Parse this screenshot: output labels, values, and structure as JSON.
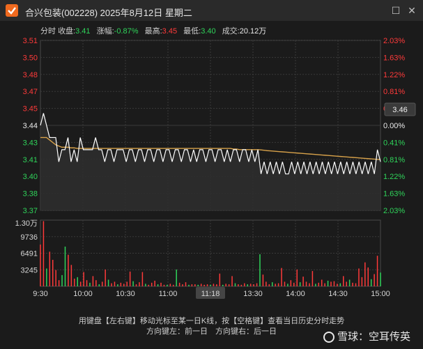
{
  "window": {
    "title": "合兴包装(002228) 2025年8月12日 星期二",
    "close_glyph": "✕",
    "maximize_glyph": "☐"
  },
  "info_bar": {
    "mode_label": "分时",
    "close_label": "收盘:",
    "close_value": "3.41",
    "change_label": "涨幅:",
    "change_value": "-0.87%",
    "high_label": "最高:",
    "high_value": "3.45",
    "low_label": "最低:",
    "low_value": "3.40",
    "volume_label": "成交:",
    "volume_value": "20.12万"
  },
  "current_price_tag": "3.46",
  "colors": {
    "up": "#ff3a3a",
    "down": "#2fd45a",
    "price_line": "#ffffff",
    "avg_line": "#d8a24a",
    "grid": "#3a3a3a",
    "background": "#1b1b1b"
  },
  "chart_data": {
    "type": "line",
    "price_axis": {
      "ticks": [
        "3.51",
        "3.50",
        "3.48",
        "3.47",
        "3.45",
        "3.44",
        "3.43",
        "3.41",
        "3.40",
        "3.38",
        "3.37"
      ],
      "tick_colors": [
        "up",
        "up",
        "up",
        "up",
        "up",
        "white",
        "down",
        "down",
        "down",
        "down",
        "down"
      ],
      "ylim": [
        3.37,
        3.51
      ],
      "prev_close": 3.44
    },
    "pct_axis": {
      "ticks": [
        "2.03%",
        "1.63%",
        "1.22%",
        "0.81%",
        "0.41%",
        "0.00%",
        "0.41%",
        "0.81%",
        "1.22%",
        "1.63%",
        "2.03%"
      ],
      "tick_colors": [
        "up",
        "up",
        "up",
        "up",
        "up",
        "white",
        "down",
        "down",
        "down",
        "down",
        "down"
      ]
    },
    "time_axis": {
      "ticks": [
        "9:30",
        "10:00",
        "10:30",
        "11:00",
        "11:18",
        "13:30",
        "14:00",
        "14:30",
        "15:00"
      ],
      "highlight": "11:18"
    },
    "volume_axis": {
      "ticks": [
        "1.30万",
        "9736",
        "6491",
        "3245"
      ],
      "ylim": [
        0,
        13000
      ]
    },
    "price_series": [
      3.44,
      3.45,
      3.44,
      3.43,
      3.43,
      3.43,
      3.41,
      3.42,
      3.42,
      3.43,
      3.41,
      3.42,
      3.41,
      3.43,
      3.42,
      3.42,
      3.42,
      3.42,
      3.43,
      3.42,
      3.42,
      3.41,
      3.42,
      3.42,
      3.41,
      3.42,
      3.42,
      3.42,
      3.41,
      3.42,
      3.42,
      3.41,
      3.42,
      3.42,
      3.41,
      3.42,
      3.42,
      3.41,
      3.42,
      3.42,
      3.41,
      3.42,
      3.42,
      3.41,
      3.42,
      3.42,
      3.41,
      3.42,
      3.42,
      3.41,
      3.42,
      3.41,
      3.42,
      3.42,
      3.41,
      3.42,
      3.42,
      3.41,
      3.42,
      3.42,
      3.41,
      3.42,
      3.41,
      3.42,
      3.42,
      3.41,
      3.42,
      3.42,
      3.41,
      3.42,
      3.41,
      3.42,
      3.4,
      3.41,
      3.4,
      3.41,
      3.4,
      3.41,
      3.4,
      3.41,
      3.4,
      3.4,
      3.41,
      3.4,
      3.41,
      3.4,
      3.41,
      3.4,
      3.41,
      3.4,
      3.41,
      3.4,
      3.41,
      3.4,
      3.41,
      3.4,
      3.41,
      3.4,
      3.41,
      3.4,
      3.41,
      3.4,
      3.41,
      3.4,
      3.41,
      3.4,
      3.41,
      3.4,
      3.41,
      3.4,
      3.42,
      3.41
    ],
    "avg_series": [
      3.43,
      3.43,
      3.43,
      3.428,
      3.426,
      3.424,
      3.423,
      3.422,
      3.422,
      3.422,
      3.4215,
      3.4215,
      3.421,
      3.421,
      3.421,
      3.421,
      3.421,
      3.421,
      3.421,
      3.421,
      3.421,
      3.421,
      3.421,
      3.421,
      3.421,
      3.421,
      3.421,
      3.421,
      3.421,
      3.421,
      3.421,
      3.421,
      3.421,
      3.421,
      3.421,
      3.421,
      3.421,
      3.421,
      3.421,
      3.421,
      3.421,
      3.421,
      3.421,
      3.421,
      3.421,
      3.421,
      3.421,
      3.421,
      3.421,
      3.421,
      3.421,
      3.421,
      3.421,
      3.421,
      3.421,
      3.421,
      3.421,
      3.421,
      3.421,
      3.421,
      3.421,
      3.421,
      3.421,
      3.4205,
      3.4205,
      3.42,
      3.42,
      3.42,
      3.42,
      3.42,
      3.42,
      3.42,
      3.4198,
      3.4195,
      3.4192,
      3.419,
      3.4188,
      3.4186,
      3.4184,
      3.4182,
      3.418,
      3.4178,
      3.4176,
      3.4174,
      3.4172,
      3.417,
      3.4168,
      3.4166,
      3.4164,
      3.4162,
      3.416,
      3.4158,
      3.4156,
      3.4154,
      3.4152,
      3.415,
      3.4148,
      3.4146,
      3.4144,
      3.4142,
      3.414,
      3.4138,
      3.4136,
      3.4134,
      3.4132,
      3.413,
      3.4128,
      3.4126,
      3.4124,
      3.4122,
      3.412,
      3.412
    ],
    "volume_series": [
      {
        "v": 8200,
        "d": "up"
      },
      {
        "v": 12800,
        "d": "up"
      },
      {
        "v": 3500,
        "d": "down"
      },
      {
        "v": 6800,
        "d": "up"
      },
      {
        "v": 5200,
        "d": "up"
      },
      {
        "v": 3200,
        "d": "up"
      },
      {
        "v": 1200,
        "d": "up"
      },
      {
        "v": 2200,
        "d": "down"
      },
      {
        "v": 7800,
        "d": "down"
      },
      {
        "v": 6200,
        "d": "up"
      },
      {
        "v": 4200,
        "d": "up"
      },
      {
        "v": 1500,
        "d": "up"
      },
      {
        "v": 1800,
        "d": "down"
      },
      {
        "v": 900,
        "d": "up"
      },
      {
        "v": 2800,
        "d": "up"
      },
      {
        "v": 1200,
        "d": "up"
      },
      {
        "v": 700,
        "d": "down"
      },
      {
        "v": 2000,
        "d": "up"
      },
      {
        "v": 1200,
        "d": "up"
      },
      {
        "v": 400,
        "d": "down"
      },
      {
        "v": 900,
        "d": "up"
      },
      {
        "v": 3300,
        "d": "up"
      },
      {
        "v": 1300,
        "d": "down"
      },
      {
        "v": 600,
        "d": "up"
      },
      {
        "v": 900,
        "d": "up"
      },
      {
        "v": 400,
        "d": "down"
      },
      {
        "v": 700,
        "d": "up"
      },
      {
        "v": 500,
        "d": "up"
      },
      {
        "v": 900,
        "d": "up"
      },
      {
        "v": 2900,
        "d": "up"
      },
      {
        "v": 1000,
        "d": "down"
      },
      {
        "v": 400,
        "d": "up"
      },
      {
        "v": 800,
        "d": "up"
      },
      {
        "v": 2800,
        "d": "up"
      },
      {
        "v": 500,
        "d": "down"
      },
      {
        "v": 300,
        "d": "up"
      },
      {
        "v": 700,
        "d": "up"
      },
      {
        "v": 1100,
        "d": "up"
      },
      {
        "v": 400,
        "d": "down"
      },
      {
        "v": 700,
        "d": "up"
      },
      {
        "v": 300,
        "d": "up"
      },
      {
        "v": 300,
        "d": "down"
      },
      {
        "v": 500,
        "d": "up"
      },
      {
        "v": 300,
        "d": "up"
      },
      {
        "v": 3300,
        "d": "down"
      },
      {
        "v": 700,
        "d": "up"
      },
      {
        "v": 400,
        "d": "up"
      },
      {
        "v": 800,
        "d": "up"
      },
      {
        "v": 300,
        "d": "down"
      },
      {
        "v": 400,
        "d": "up"
      },
      {
        "v": 400,
        "d": "up"
      },
      {
        "v": 300,
        "d": "down"
      },
      {
        "v": 500,
        "d": "up"
      },
      {
        "v": 300,
        "d": "up"
      },
      {
        "v": 400,
        "d": "up"
      },
      {
        "v": 300,
        "d": "down"
      },
      {
        "v": 500,
        "d": "up"
      },
      {
        "v": 400,
        "d": "up"
      },
      {
        "v": 2500,
        "d": "up"
      },
      {
        "v": 300,
        "d": "down"
      },
      {
        "v": 500,
        "d": "up"
      },
      {
        "v": 400,
        "d": "up"
      },
      {
        "v": 2000,
        "d": "up"
      },
      {
        "v": 600,
        "d": "down"
      },
      {
        "v": 400,
        "d": "up"
      },
      {
        "v": 300,
        "d": "up"
      },
      {
        "v": 600,
        "d": "up"
      },
      {
        "v": 400,
        "d": "down"
      },
      {
        "v": 500,
        "d": "up"
      },
      {
        "v": 400,
        "d": "up"
      },
      {
        "v": 600,
        "d": "up"
      },
      {
        "v": 6300,
        "d": "down"
      },
      {
        "v": 2300,
        "d": "up"
      },
      {
        "v": 900,
        "d": "up"
      },
      {
        "v": 400,
        "d": "up"
      },
      {
        "v": 800,
        "d": "down"
      },
      {
        "v": 500,
        "d": "up"
      },
      {
        "v": 600,
        "d": "up"
      },
      {
        "v": 3600,
        "d": "up"
      },
      {
        "v": 900,
        "d": "up"
      },
      {
        "v": 500,
        "d": "down"
      },
      {
        "v": 1200,
        "d": "up"
      },
      {
        "v": 700,
        "d": "up"
      },
      {
        "v": 3300,
        "d": "up"
      },
      {
        "v": 800,
        "d": "down"
      },
      {
        "v": 1900,
        "d": "up"
      },
      {
        "v": 900,
        "d": "up"
      },
      {
        "v": 600,
        "d": "up"
      },
      {
        "v": 3000,
        "d": "up"
      },
      {
        "v": 500,
        "d": "down"
      },
      {
        "v": 700,
        "d": "up"
      },
      {
        "v": 1300,
        "d": "up"
      },
      {
        "v": 600,
        "d": "up"
      },
      {
        "v": 1100,
        "d": "down"
      },
      {
        "v": 900,
        "d": "up"
      },
      {
        "v": 1000,
        "d": "up"
      },
      {
        "v": 500,
        "d": "up"
      },
      {
        "v": 600,
        "d": "down"
      },
      {
        "v": 2000,
        "d": "up"
      },
      {
        "v": 900,
        "d": "up"
      },
      {
        "v": 1300,
        "d": "down"
      },
      {
        "v": 700,
        "d": "up"
      },
      {
        "v": 600,
        "d": "up"
      },
      {
        "v": 3500,
        "d": "up"
      },
      {
        "v": 1800,
        "d": "up"
      },
      {
        "v": 4700,
        "d": "up"
      },
      {
        "v": 3700,
        "d": "up"
      },
      {
        "v": 1400,
        "d": "down"
      },
      {
        "v": 2400,
        "d": "up"
      },
      {
        "v": 6000,
        "d": "up"
      },
      {
        "v": 2700,
        "d": "down"
      }
    ]
  },
  "footer": {
    "hint_line1": "用键盘【左右键】移动光标至某一日K线，按【空格键】查看当日历史分时走势",
    "hint_line2": "方向键左：前一日　方向键右：后一日",
    "brand": "雪球：空耳传英"
  }
}
